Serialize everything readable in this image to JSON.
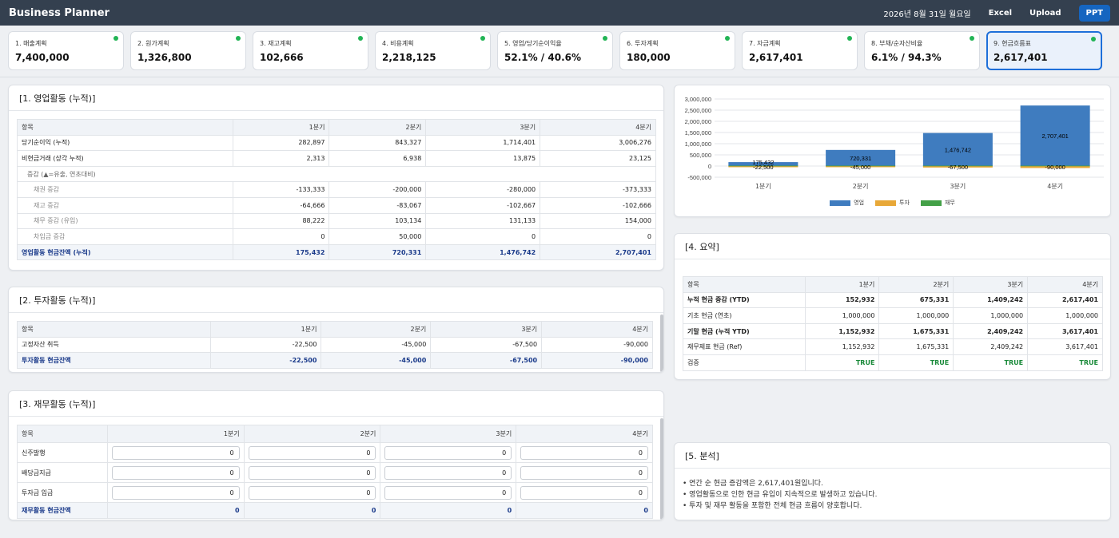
{
  "app": {
    "title": "Business Planner",
    "date": "2026년 8월 31일 월요일",
    "excel": "Excel",
    "upload": "Upload",
    "ppt": "PPT"
  },
  "cards": [
    {
      "title": "1. 매출계획",
      "value": "7,400,000"
    },
    {
      "title": "2. 원가계획",
      "value": "1,326,800"
    },
    {
      "title": "3. 재고계획",
      "value": "102,666"
    },
    {
      "title": "4. 비용계획",
      "value": "2,218,125"
    },
    {
      "title": "5. 영업/당기순이익율",
      "value": "52.1% / 40.6%"
    },
    {
      "title": "6. 투자계획",
      "value": "180,000"
    },
    {
      "title": "7. 자금계획",
      "value": "2,617,401"
    },
    {
      "title": "8. 부채/순자산비율",
      "value": "6.1% / 94.3%"
    },
    {
      "title": "9. 현금흐름표",
      "value": "2,617,401"
    }
  ],
  "operating": {
    "title": "[1. 영업활동 (누적)]",
    "headers": [
      "항목",
      "1분기",
      "2분기",
      "3분기",
      "4분기"
    ],
    "rows": [
      {
        "label": "당기순이익 (누적)",
        "v": [
          "282,897",
          "843,327",
          "1,714,401",
          "3,006,276"
        ]
      },
      {
        "label": "비현금거래 (상각 누적)",
        "v": [
          "2,313",
          "6,938",
          "13,875",
          "23,125"
        ]
      },
      {
        "label": "증감 (▲=유출, 연초대비)",
        "v": []
      },
      {
        "label": "채권 증감",
        "v": [
          "-133,333",
          "-200,000",
          "-280,000",
          "-373,333"
        ]
      },
      {
        "label": "재고 증감",
        "v": [
          "-64,666",
          "-83,067",
          "-102,667",
          "-102,666"
        ]
      },
      {
        "label": "채무 증감 (유입)",
        "v": [
          "88,222",
          "103,134",
          "131,133",
          "154,000"
        ]
      },
      {
        "label": "차입금 증감",
        "v": [
          "0",
          "50,000",
          "0",
          "0"
        ]
      }
    ],
    "total": {
      "label": "영업활동 현금잔액 (누적)",
      "v": [
        "175,432",
        "720,331",
        "1,476,742",
        "2,707,401"
      ]
    }
  },
  "investing": {
    "title": "[2. 투자활동 (누적)]",
    "headers": [
      "항목",
      "1분기",
      "2분기",
      "3분기",
      "4분기"
    ],
    "rows": [
      {
        "label": "고정자산 취득",
        "v": [
          "-22,500",
          "-45,000",
          "-67,500",
          "-90,000"
        ]
      }
    ],
    "total": {
      "label": "투자활동 현금잔액",
      "v": [
        "-22,500",
        "-45,000",
        "-67,500",
        "-90,000"
      ]
    }
  },
  "financing": {
    "title": "[3. 재무활동 (누적)]",
    "headers": [
      "항목",
      "1분기",
      "2분기",
      "3분기",
      "4분기"
    ],
    "rows": [
      {
        "label": "신주발행",
        "v": [
          "0",
          "0",
          "0",
          "0"
        ]
      },
      {
        "label": "배당금지급",
        "v": [
          "0",
          "0",
          "0",
          "0"
        ]
      },
      {
        "label": "투자금 입금",
        "v": [
          "0",
          "0",
          "0",
          "0"
        ]
      }
    ],
    "total": {
      "label": "재무활동 현금잔액",
      "v": [
        "0",
        "0",
        "0",
        "0"
      ]
    }
  },
  "summary": {
    "title": "[4. 요약]",
    "headers": [
      "항목",
      "1분기",
      "2분기",
      "3분기",
      "4분기"
    ],
    "rows": [
      {
        "label": "누적 현금 증감 (YTD)",
        "v": [
          "152,932",
          "675,331",
          "1,409,242",
          "2,617,401"
        ],
        "bold": true
      },
      {
        "label": "기초 현금 (연초)",
        "v": [
          "1,000,000",
          "1,000,000",
          "1,000,000",
          "1,000,000"
        ]
      },
      {
        "label": "기말 현금 (누적 YTD)",
        "v": [
          "1,152,932",
          "1,675,331",
          "2,409,242",
          "3,617,401"
        ],
        "bold": true
      },
      {
        "label": "재무제표 현금 (Ref)",
        "v": [
          "1,152,932",
          "1,675,331",
          "2,409,242",
          "3,617,401"
        ]
      },
      {
        "label": "검증",
        "v": [
          "TRUE",
          "TRUE",
          "TRUE",
          "TRUE"
        ],
        "ok": true
      }
    ]
  },
  "analysis": {
    "title": "[5. 분석]",
    "lines": [
      "• 연간 순 현금 증감액은 2,617,401원입니다.",
      "• 영업활동으로 인한 현금 유입이 지속적으로 발생하고 있습니다.",
      "• 투자 및 재무 활동을 포함한 전체 현금 흐름이 양호합니다."
    ]
  },
  "chart_data": {
    "type": "bar",
    "categories": [
      "1분기",
      "2분기",
      "3분기",
      "4분기"
    ],
    "series": [
      {
        "name": "영업",
        "values": [
          175432,
          720331,
          1476742,
          2707401
        ],
        "color": "#3f7cbf"
      },
      {
        "name": "투자",
        "values": [
          -22500,
          -45000,
          -67500,
          -90000
        ],
        "color": "#e8a838"
      },
      {
        "name": "재무",
        "values": [
          0,
          0,
          0,
          0
        ],
        "color": "#43a047"
      }
    ],
    "yticks": [
      "3,000,000",
      "2,500,000",
      "2,000,000",
      "1,500,000",
      "1,000,000",
      "500,000",
      "0",
      "-500,000"
    ],
    "data_labels": [
      {
        "op": "175,432",
        "inv": "-22,500"
      },
      {
        "op": "720,331",
        "inv": "-45,000"
      },
      {
        "op": "1,476,742",
        "inv": "-67,500"
      },
      {
        "op": "2,707,401",
        "inv": "-90,000"
      }
    ],
    "ylim": [
      -500000,
      3000000
    ],
    "grid": true,
    "legend_position": "bottom"
  }
}
